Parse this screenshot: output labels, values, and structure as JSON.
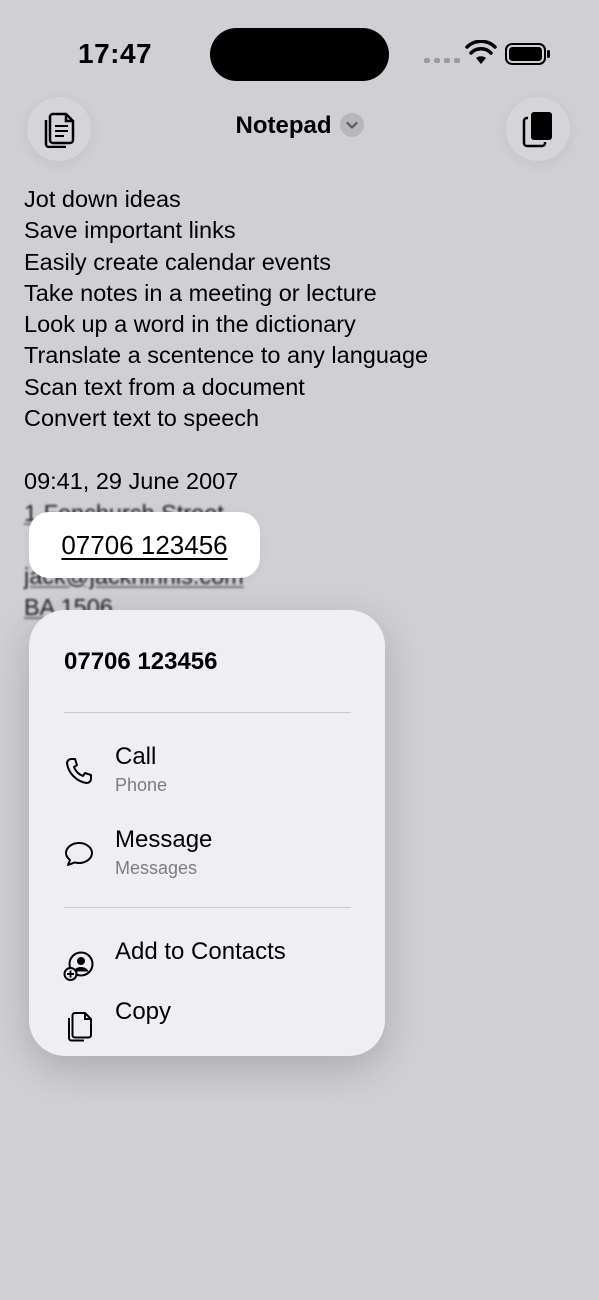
{
  "status_bar": {
    "time": "17:47"
  },
  "nav": {
    "title": "Notepad"
  },
  "notes": [
    "Jot down ideas",
    "Save important links",
    "Easily create calendar events",
    "Take notes in a meeting or lecture",
    "Look up a word in the dictionary",
    "Translate a scentence to any language",
    "Scan text from a document",
    "Convert text to speech"
  ],
  "details": {
    "datetime": "09:41, 29 June 2007",
    "address": "1 Fenchurch Street",
    "email": "jack@jackhinnis.com",
    "flight": "BA 1506"
  },
  "selected_phone": "07706 123456",
  "menu": {
    "header": "07706 123456",
    "call": {
      "label": "Call",
      "sub": "Phone"
    },
    "message": {
      "label": "Message",
      "sub": "Messages"
    },
    "add_contacts": {
      "label": "Add to Contacts"
    },
    "copy": {
      "label": "Copy"
    }
  }
}
